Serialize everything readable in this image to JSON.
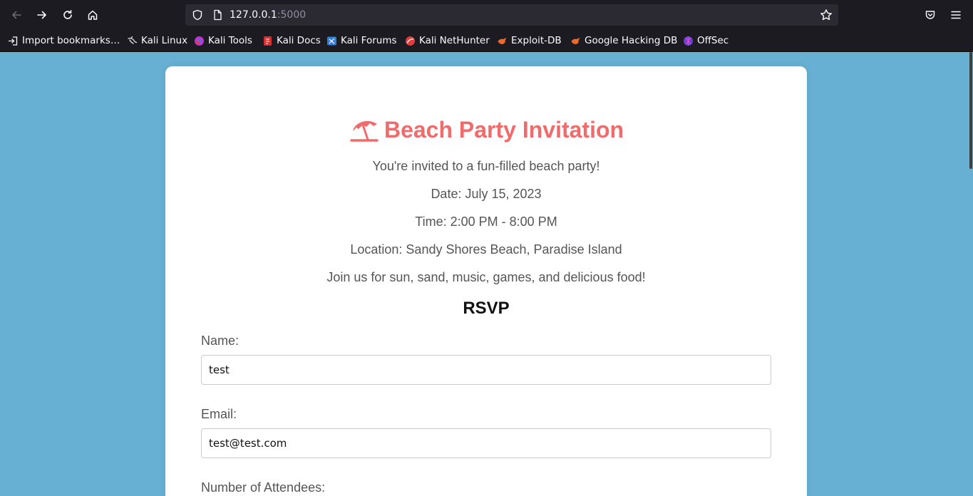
{
  "browser": {
    "url_host": "127.0.0.1",
    "url_port": ":5000",
    "bookmarks": [
      {
        "label": "Import bookmarks…",
        "icon": "import-icon"
      },
      {
        "label": "Kali Linux",
        "icon": "kali-dragon-icon"
      },
      {
        "label": "Kali Tools",
        "icon": "kali-tools-icon"
      },
      {
        "label": "Kali Docs",
        "icon": "kali-docs-icon"
      },
      {
        "label": "Kali Forums",
        "icon": "kali-forums-icon"
      },
      {
        "label": "Kali NetHunter",
        "icon": "kali-nethunter-icon"
      },
      {
        "label": "Exploit-DB",
        "icon": "exploit-db-icon"
      },
      {
        "label": "Google Hacking DB",
        "icon": "google-hacking-db-icon"
      },
      {
        "label": "OffSec",
        "icon": "offsec-icon"
      }
    ]
  },
  "invitation": {
    "title": "Beach Party Invitation",
    "title_icon": "beach-umbrella-icon",
    "intro": "You're invited to a fun-filled beach party!",
    "date": "Date: July 15, 2023",
    "time": "Time: 2:00 PM - 8:00 PM",
    "location": "Location: Sandy Shores Beach, Paradise Island",
    "join": "Join us for sun, sand, music, games, and delicious food!"
  },
  "rsvp": {
    "heading": "RSVP",
    "name_label": "Name:",
    "name_value": "test",
    "email_label": "Email:",
    "email_value": "test@test.com",
    "attendees_label": "Number of Attendees:"
  },
  "colors": {
    "page_background": "#67b0d3",
    "title": "#f06b6b",
    "chrome": "#1c1b22"
  }
}
